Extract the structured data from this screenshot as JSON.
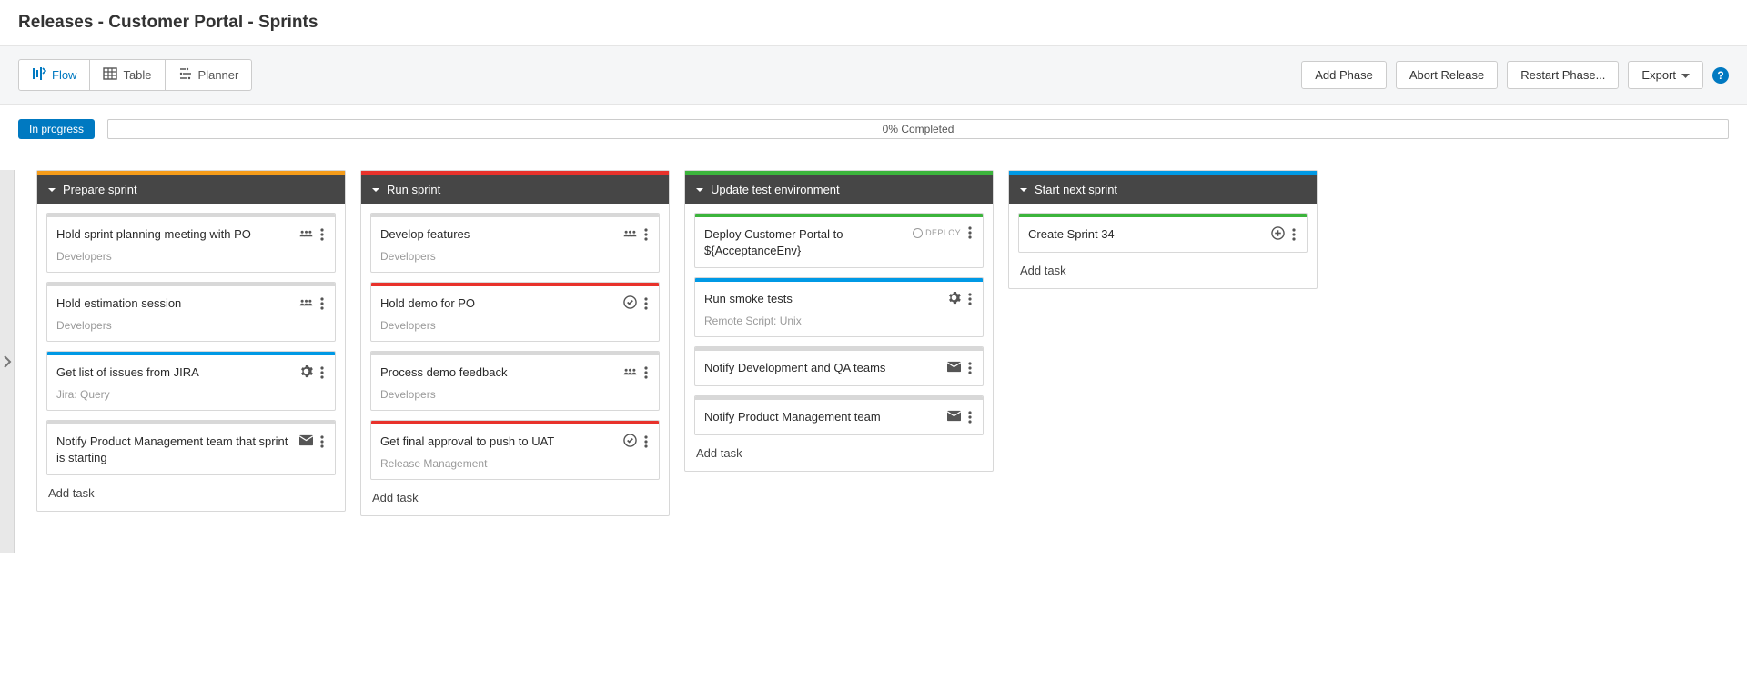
{
  "page_title": "Releases - Customer Portal - Sprints",
  "tabs": {
    "flow": "Flow",
    "table": "Table",
    "planner": "Planner"
  },
  "buttons": {
    "add_phase": "Add Phase",
    "abort_release": "Abort Release",
    "restart_phase": "Restart Phase...",
    "export": "Export"
  },
  "status_badge": "In progress",
  "progress_text": "0% Completed",
  "add_task_label": "Add task",
  "columns": [
    {
      "title": "Prepare sprint",
      "accent": "accent-orange",
      "has_add_task": true,
      "cards": [
        {
          "title": "Hold sprint planning meeting with PO",
          "subtitle": "Developers",
          "icon_type": "team",
          "accent": "accent-grey"
        },
        {
          "title": "Hold estimation session",
          "subtitle": "Developers",
          "icon_type": "team",
          "accent": "accent-grey"
        },
        {
          "title": "Get list of issues from JIRA",
          "subtitle": "Jira: Query",
          "icon_type": "gear",
          "accent": "accent-blue"
        },
        {
          "title": "Notify Product Management team that sprint is starting",
          "subtitle": "",
          "icon_type": "mail",
          "accent": "accent-grey"
        }
      ]
    },
    {
      "title": "Run sprint",
      "accent": "accent-red",
      "has_add_task": true,
      "cards": [
        {
          "title": "Develop features",
          "subtitle": "Developers",
          "icon_type": "team",
          "accent": "accent-grey"
        },
        {
          "title": "Hold demo for PO",
          "subtitle": "Developers",
          "icon_type": "check",
          "accent": "accent-red"
        },
        {
          "title": "Process demo feedback",
          "subtitle": "Developers",
          "icon_type": "team",
          "accent": "accent-grey"
        },
        {
          "title": "Get final approval to push to UAT",
          "subtitle": "Release Management",
          "icon_type": "check",
          "accent": "accent-red"
        }
      ]
    },
    {
      "title": "Update test environment",
      "accent": "accent-green",
      "has_add_task": true,
      "cards": [
        {
          "title": "Deploy Customer Portal to ${AcceptanceEnv}",
          "subtitle": "",
          "icon_type": "deploy",
          "accent": "accent-green"
        },
        {
          "title": "Run smoke tests",
          "subtitle": "Remote Script: Unix",
          "icon_type": "gear",
          "accent": "accent-blue"
        },
        {
          "title": "Notify Development and QA teams",
          "subtitle": "",
          "icon_type": "mail",
          "accent": "accent-grey"
        },
        {
          "title": "Notify Product Management team",
          "subtitle": "",
          "icon_type": "mail",
          "accent": "accent-grey"
        }
      ]
    },
    {
      "title": "Start next sprint",
      "accent": "accent-blue",
      "has_add_task": true,
      "cards": [
        {
          "title": "Create Sprint 34",
          "subtitle": "",
          "icon_type": "plus",
          "accent": "accent-green"
        }
      ]
    }
  ]
}
